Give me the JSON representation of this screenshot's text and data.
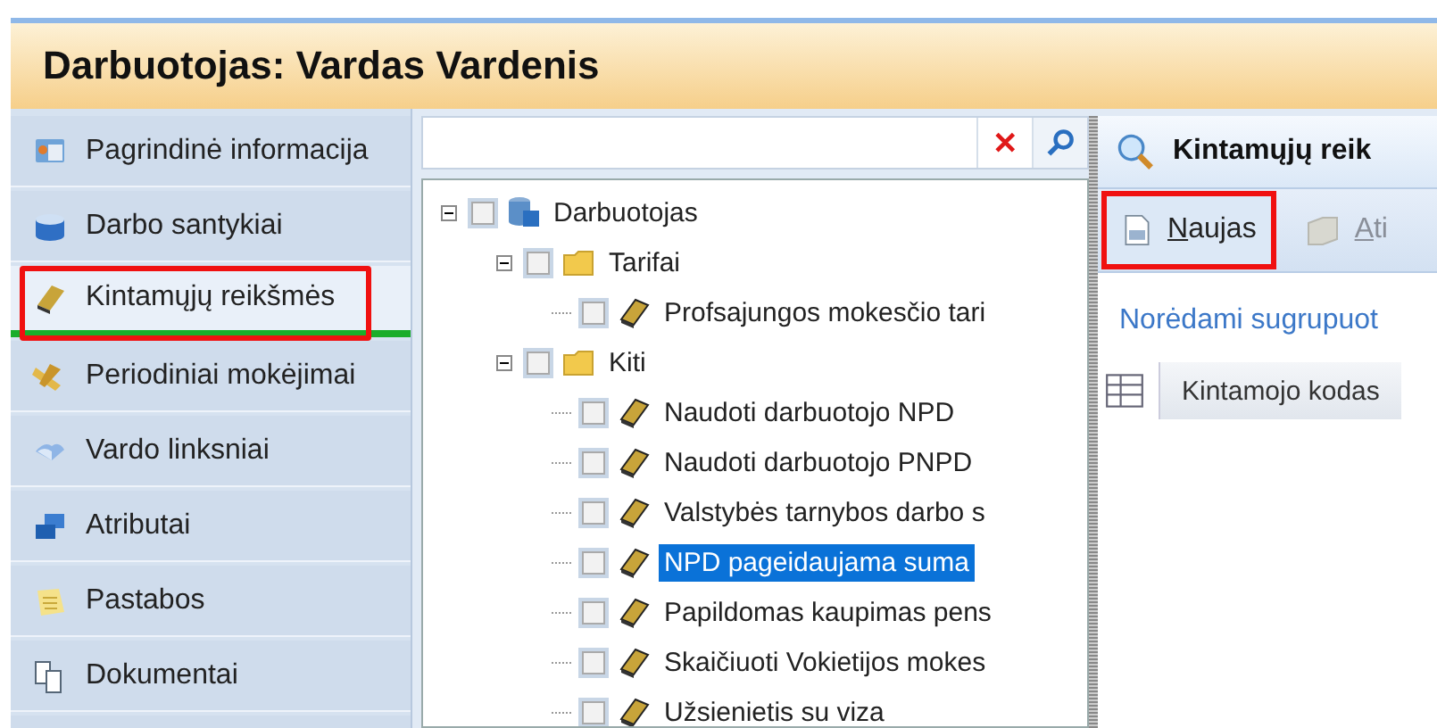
{
  "window": {
    "title": "Darbuotojas: Vardas Vardenis"
  },
  "sidebar": {
    "items": [
      {
        "label": "Pagrindinė informacija",
        "kind": "card",
        "selected": false
      },
      {
        "label": "Darbo santykiai",
        "kind": "box",
        "selected": false
      },
      {
        "label": "Kintamųjų reikšmės",
        "kind": "book",
        "selected": true
      },
      {
        "label": "Periodiniai mokėjimai",
        "kind": "scroll",
        "selected": false
      },
      {
        "label": "Vardo linksniai",
        "kind": "openbook",
        "selected": false
      },
      {
        "label": "Atributai",
        "kind": "windows",
        "selected": false
      },
      {
        "label": "Pastabos",
        "kind": "note",
        "selected": false
      },
      {
        "label": "Dokumentai",
        "kind": "docs",
        "selected": false
      }
    ]
  },
  "tree_panel": {
    "search": {
      "clear": "✕"
    },
    "tree": [
      {
        "label": "Darbuotojas",
        "kind": "database",
        "checked": false,
        "expanded": true,
        "selected": false,
        "children": [
          {
            "label": "Tarifai",
            "kind": "folder",
            "checked": false,
            "expanded": true,
            "selected": false,
            "children": [
              {
                "label": "Profsajungos mokesčio tari",
                "kind": "book",
                "checked": false,
                "selected": false
              }
            ]
          },
          {
            "label": "Kiti",
            "kind": "folder",
            "checked": false,
            "expanded": true,
            "selected": false,
            "children": [
              {
                "label": "Naudoti darbuotojo NPD",
                "kind": "book",
                "checked": false,
                "selected": false
              },
              {
                "label": "Naudoti darbuotojo PNPD",
                "kind": "book",
                "checked": false,
                "selected": false
              },
              {
                "label": "Valstybės tarnybos darbo s",
                "kind": "book",
                "checked": false,
                "selected": false
              },
              {
                "label": "NPD pageidaujama suma",
                "kind": "book",
                "checked": false,
                "selected": true
              },
              {
                "label": "Papildomas kaupimas pens",
                "kind": "book",
                "checked": false,
                "selected": false
              },
              {
                "label": "Skaičiuoti Vokietijos mokes",
                "kind": "book",
                "checked": false,
                "selected": false
              },
              {
                "label": "Užsienietis su viza",
                "kind": "book",
                "checked": false,
                "selected": false
              }
            ]
          }
        ]
      }
    ]
  },
  "detail_panel": {
    "title": "Kintamųjų reik",
    "toolbar": [
      {
        "label": "Naujas",
        "kind": "new",
        "highlighted": true
      },
      {
        "label": "Ati",
        "kind": "open",
        "highlighted": false
      }
    ],
    "group_hint": "Norėdami sugrupuot",
    "columns": [
      "Kintamojo kodas"
    ]
  }
}
